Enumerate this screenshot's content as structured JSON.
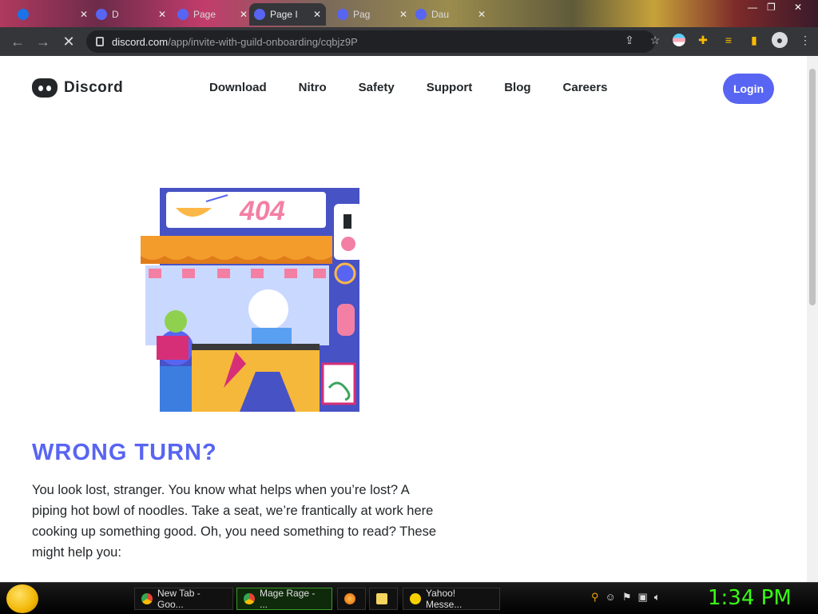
{
  "browser": {
    "tabs": [
      {
        "title": "",
        "active": false
      },
      {
        "title": "D",
        "active": false
      },
      {
        "title": "Page",
        "active": false
      },
      {
        "title": "Page I",
        "active": true
      },
      {
        "title": "Pag",
        "active": false
      },
      {
        "title": "Dau",
        "active": false
      }
    ],
    "url_domain": "discord.com",
    "url_path": "/app/invite-with-guild-onboarding/cqbjz9P"
  },
  "site": {
    "logo_text": "Discord",
    "nav": [
      "Download",
      "Nitro",
      "Safety",
      "Support",
      "Blog",
      "Careers"
    ],
    "login_label": "Login",
    "illustration_text": "404",
    "heading": "WRONG TURN?",
    "body": "You look lost, stranger. You know what helps when you’re lost? A piping hot bowl of noodles. Take a seat, we’re frantically at work here cooking up something good. Oh, you need something to read? These might help you:"
  },
  "taskbar": {
    "buttons": [
      "New Tab - Goo...",
      "Mage Rage - ...",
      "Yahoo! Messe..."
    ],
    "clock": "1:34 PM"
  },
  "colors": {
    "brand": "#5865f2",
    "text": "#23272a",
    "clock": "#39ff14"
  }
}
